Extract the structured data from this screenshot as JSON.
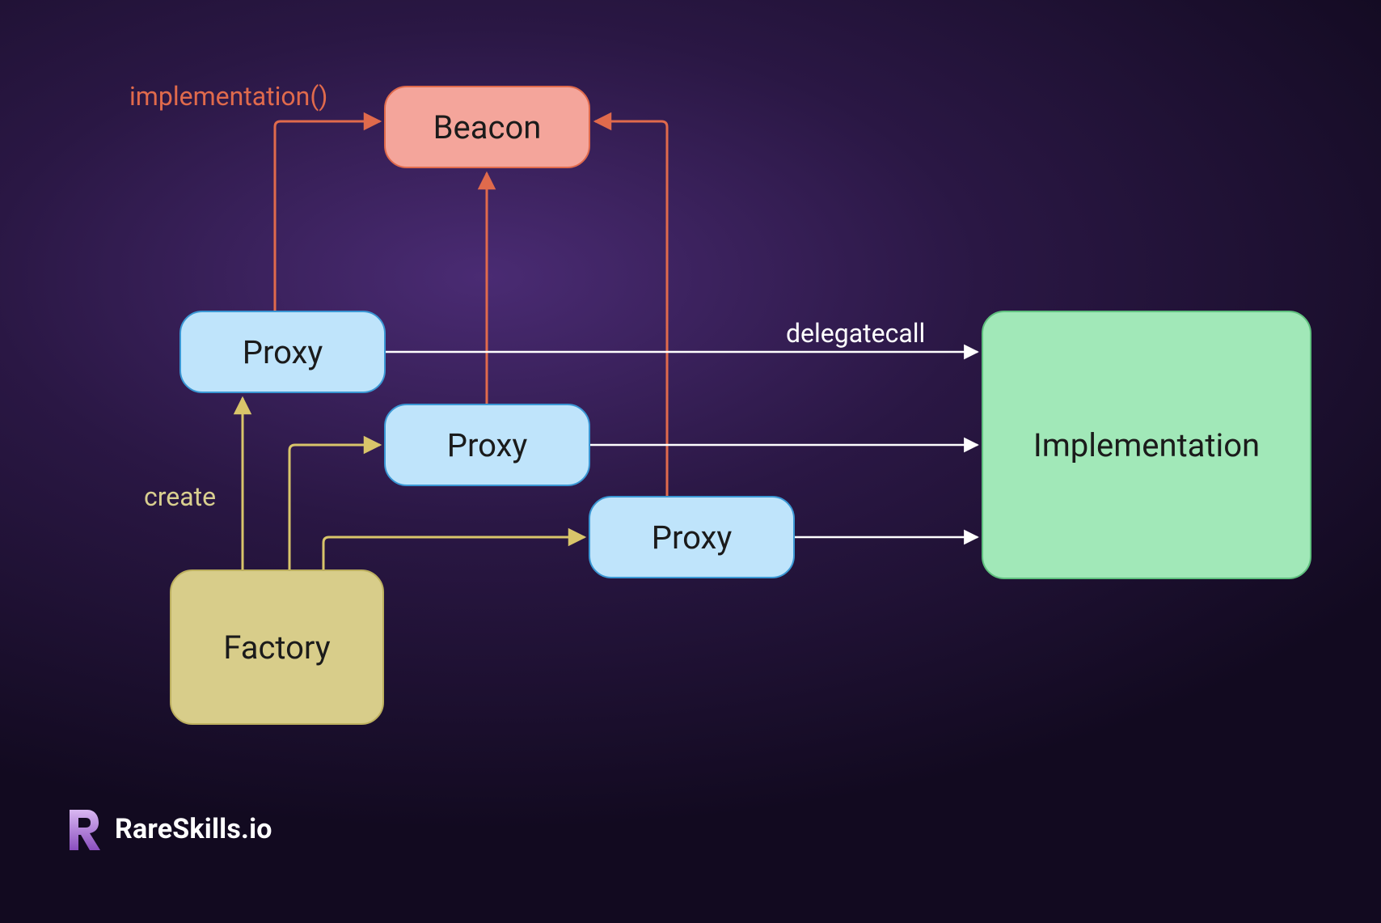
{
  "nodes": {
    "beacon": "Beacon",
    "proxy1": "Proxy",
    "proxy2": "Proxy",
    "proxy3": "Proxy",
    "implementation": "Implementation",
    "factory": "Factory"
  },
  "edge_labels": {
    "implementation_call": "implementation()",
    "create": "create",
    "delegatecall": "delegatecall"
  },
  "brand": {
    "name": "RareSkills.io"
  },
  "colors": {
    "beacon_fill": "#f4a59b",
    "beacon_stroke": "#e06a4c",
    "proxy_fill": "#bfe4fb",
    "proxy_stroke": "#3a97d4",
    "impl_fill": "#a1e8b8",
    "impl_stroke": "#5fc07e",
    "factory_fill": "#d8cd8a",
    "factory_stroke": "#bdb05f",
    "arrow_red": "#e06a4c",
    "arrow_yellow": "#d9c56a",
    "arrow_white": "#ffffff"
  }
}
